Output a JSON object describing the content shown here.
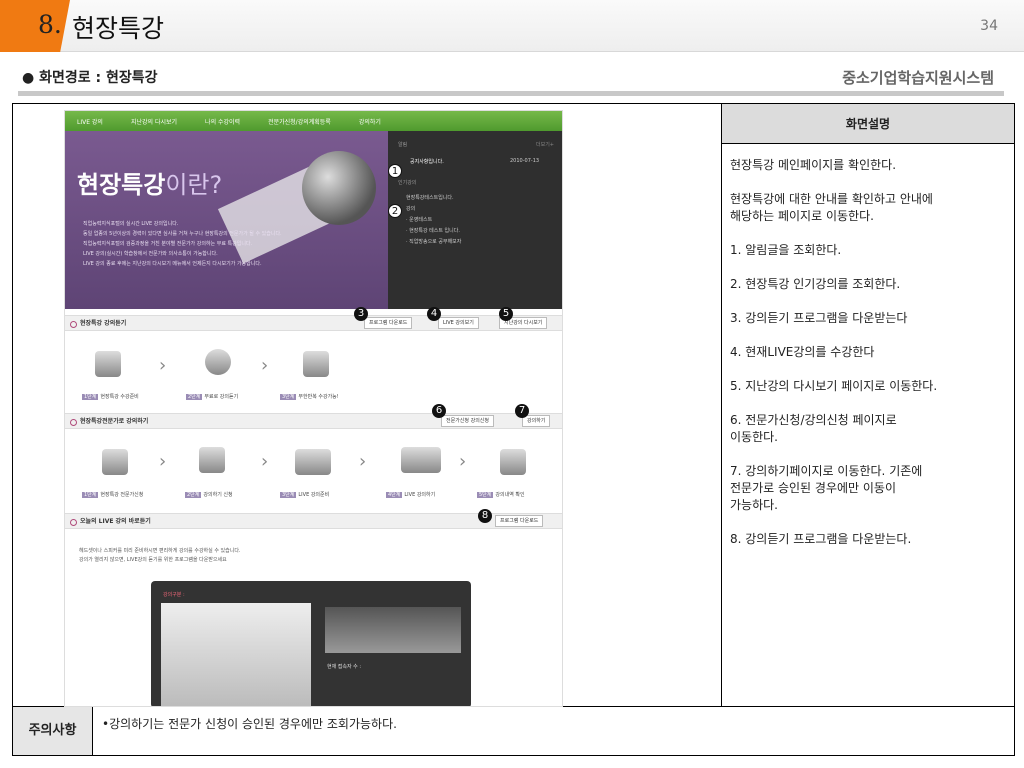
{
  "header": {
    "number": "8.",
    "title": "현장특강",
    "page": "34"
  },
  "subtitle": "● 화면경로 : 현장특강",
  "system": "중소기업학습지원시스템",
  "description": {
    "heading": "화면설명",
    "lines": [
      "현장특강 메인페이지를 확인한다.",
      "현장특강에 대한 안내를 확인하고 안내에\n해당하는 페이지로 이동한다.",
      "1. 알림글을 조회한다.",
      "2. 현장특강 인기강의를 조회한다.",
      "3. 강의듣기 프로그램을 다운받는다",
      "4. 현재LIVE강의를 수강한다",
      "5. 지난강의 다시보기 페이지로 이동한다.",
      "6. 전문가신청/강의신청 페이지로\n이동한다.",
      "7. 강의하기페이지로 이동한다. 기존에\n전문가로 승인된 경우에만 이동이\n가능하다.",
      "8. 강의듣기 프로그램을 다운받는다."
    ]
  },
  "notes": {
    "label": "주의사항",
    "text": "•강의하기는 전문가 신청이 승인된 경우에만 조회가능하다."
  },
  "screenshot": {
    "nav": [
      "LIVE 강의",
      "지난강의 다시보기",
      "나의 수강이력",
      "전문가신청/강의계획등록",
      "강의하기"
    ],
    "hero_title": "현장특강",
    "hero_title_suffix": "이란?",
    "hero_text": [
      "직업능력지식포털의 실시간 LIVE 강의입니다.",
      "동일 업종의 5년이상의 경력이 있다면 심사를 거쳐 누구나 현장특강의 전문가가 될 수 있습니다.",
      "직업능력지식포털의 검증과정을 거친 분야별 전문가가 강의하는 무료 특강입니다.",
      "LIVE 강의(실시간) 학습창에서 전문가와 의사소통이 가능합니다.",
      "LIVE 강의 종료 후에는 지난강의 다시보기 메뉴에서 언제든지 다시보기가 가능합니다."
    ],
    "notice": {
      "label": "알림",
      "more": "더보기+",
      "item": "공지사항입니다.",
      "date": "2010-07-13",
      "popular_label": "인기강의",
      "popular": [
        "현장특강테스트입니다.",
        "강의",
        "· 운영테스트",
        "· 현장특강 테스트 입니다.",
        "· 직업방송으로 공부해보자"
      ]
    },
    "section1": "현장특강 강의듣기",
    "buttons1": [
      "프로그램 다운로드",
      "LIVE 강의보기",
      "지난강의 다시보기"
    ],
    "steps1": [
      {
        "n": "1단계",
        "t": "현장특강 수강준비"
      },
      {
        "n": "2단계",
        "t": "무료로 강의듣기"
      },
      {
        "n": "3단계",
        "t": "무한반복 수강가능!"
      }
    ],
    "section2": "현장특강전문가로 강의하기",
    "buttons2": [
      "전문가신청 강의신청",
      "강의하기"
    ],
    "steps2": [
      {
        "n": "1단계",
        "t": "현장특강 전문가신청"
      },
      {
        "n": "2단계",
        "t": "강의하기 신청"
      },
      {
        "n": "3단계",
        "t": "LIVE 강의준비"
      },
      {
        "n": "4단계",
        "t": "LIVE 강의하기"
      },
      {
        "n": "5단계",
        "t": "강의내역 확인"
      }
    ],
    "section3": "오늘의 LIVE 강의 바로듣기",
    "button3": "프로그램 다운로드",
    "live_text": [
      "헤드셋이나 스피커를 미리 준비하시면 편리하게 강의를 수강하실 수 있습니다.",
      "강의가 열리지 않으면, LIVE강의 듣기를 위한 프로그램을 다운받으세요"
    ],
    "player_label": "강의구분 :",
    "player_count": "현재 접속자 수 :",
    "badges": [
      "1",
      "2",
      "3",
      "4",
      "5",
      "6",
      "7",
      "8"
    ]
  }
}
